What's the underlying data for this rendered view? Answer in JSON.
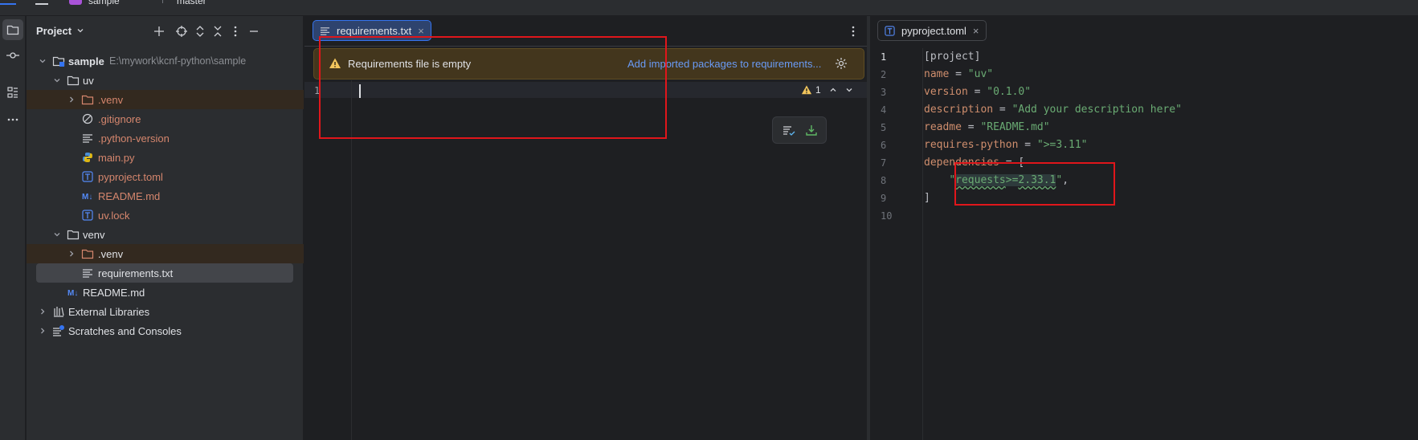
{
  "topbar": {
    "project_name": "sample",
    "branch": "master"
  },
  "project_panel": {
    "title": "Project",
    "tree": [
      {
        "label": "sample",
        "path": "E:\\mywork\\kcnf-python\\sample"
      },
      {
        "label": "uv"
      },
      {
        "label": ".venv"
      },
      {
        "label": ".gitignore"
      },
      {
        "label": ".python-version"
      },
      {
        "label": "main.py"
      },
      {
        "label": "pyproject.toml"
      },
      {
        "label": "README.md"
      },
      {
        "label": "uv.lock"
      },
      {
        "label": "venv"
      },
      {
        "label": ".venv"
      },
      {
        "label": "requirements.txt"
      },
      {
        "label": "README.md"
      },
      {
        "label": "External Libraries"
      },
      {
        "label": "Scratches and Consoles"
      }
    ]
  },
  "editor_left": {
    "tab_label": "requirements.txt",
    "banner_text": "Requirements file is empty",
    "banner_link": "Add imported packages to requirements...",
    "line_numbers": [
      "1"
    ],
    "warning_count": "1"
  },
  "editor_right": {
    "tab_label": "pyproject.toml",
    "line_numbers": [
      "1",
      "2",
      "3",
      "4",
      "5",
      "6",
      "7",
      "8",
      "9",
      "10"
    ],
    "lines": [
      {
        "key": "[project]"
      },
      {
        "key": "name",
        "value": "\"uv\""
      },
      {
        "key": "version",
        "value": "\"0.1.0\""
      },
      {
        "key": "description",
        "value": "\"Add your description here\""
      },
      {
        "key": "readme",
        "value": "\"README.md\""
      },
      {
        "key": "requires-python",
        "value": "\">=3.11\""
      },
      {
        "key": "dependencies",
        "value": "["
      },
      {
        "pkg": "requests",
        "op": ">=",
        "ver": "2.33.1"
      },
      {
        "key": "]"
      },
      {
        "key": ""
      }
    ]
  },
  "colors": {
    "accent": "#3574f0",
    "excluded_folder": "#d5866d",
    "annotation_red": "#e0161b",
    "string_green": "#6aab73"
  }
}
